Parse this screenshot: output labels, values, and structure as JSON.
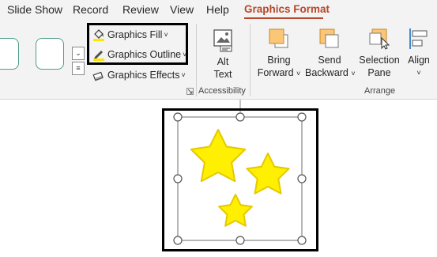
{
  "tabs": [
    {
      "label": "Slide Show",
      "active": false
    },
    {
      "label": "Record",
      "active": false
    },
    {
      "label": "Review",
      "active": false
    },
    {
      "label": "View",
      "active": false
    },
    {
      "label": "Help",
      "active": false
    },
    {
      "label": "Graphics Format",
      "active": true
    }
  ],
  "colors": {
    "accent": "#b7472a",
    "ribbon_bg": "#f3f3f3",
    "style_thumb_border": "#4f9c8a",
    "star_fill": "#ffef00",
    "star_stroke": "#e6c800",
    "arrange_icon_fill": "#fbc676",
    "fill_bar": "#ffe600"
  },
  "graphics_styles": {
    "gallery_icons": [
      "scroll-up-icon",
      "scroll-down-icon",
      "more-icon"
    ],
    "commands": [
      {
        "label": "Graphics Fill",
        "icon": "paint-bucket-icon",
        "dropdown": "˅"
      },
      {
        "label": "Graphics Outline",
        "icon": "pencil-outline-icon",
        "dropdown": "˅"
      },
      {
        "label": "Graphics Effects",
        "icon": "effects-icon",
        "dropdown": "˅"
      }
    ]
  },
  "accessibility": {
    "alt_text_line1": "Alt",
    "alt_text_line2": "Text",
    "group_label": "Accessibility"
  },
  "arrange": {
    "bring_forward_line1": "Bring",
    "bring_forward_line2": "Forward",
    "send_backward_line1": "Send",
    "send_backward_line2": "Backward",
    "selection_pane_line1": "Selection",
    "selection_pane_line2": "Pane",
    "align_label": "Align",
    "dropdown": "˅",
    "group_label": "Arrange"
  },
  "canvas": {
    "shapes": [
      {
        "name": "star-large",
        "type": "star"
      },
      {
        "name": "star-medium",
        "type": "star"
      },
      {
        "name": "star-small",
        "type": "star"
      }
    ]
  }
}
